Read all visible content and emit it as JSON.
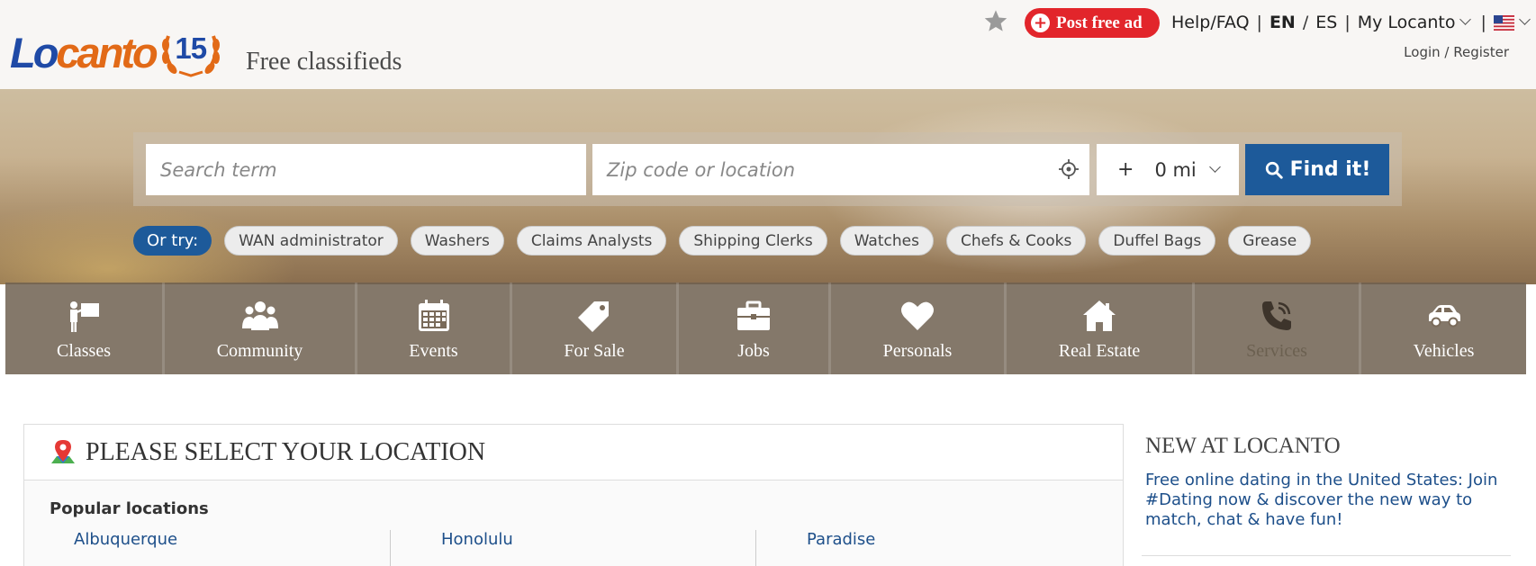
{
  "header": {
    "logo_lo": "Lo",
    "logo_canto": "canto",
    "logo_badge": "15",
    "tagline": "Free classifieds",
    "post_ad": "Post free ad",
    "help": "Help/FAQ",
    "lang_en": "EN",
    "lang_es": "ES",
    "my_locanto": "My Locanto",
    "login": "Login / Register"
  },
  "search": {
    "term_placeholder": "Search term",
    "location_placeholder": "Zip code or location",
    "radius_plus": "+",
    "radius_value": "0 mi",
    "find_label": "Find it!"
  },
  "suggestions": {
    "label": "Or try:",
    "chips": [
      "WAN administrator",
      "Washers",
      "Claims Analysts",
      "Shipping Clerks",
      "Watches",
      "Chefs & Cooks",
      "Duffel Bags",
      "Grease"
    ]
  },
  "categories": [
    {
      "label": "Classes",
      "icon": "classes-icon"
    },
    {
      "label": "Community",
      "icon": "community-icon"
    },
    {
      "label": "Events",
      "icon": "calendar-icon"
    },
    {
      "label": "For Sale",
      "icon": "tag-icon"
    },
    {
      "label": "Jobs",
      "icon": "briefcase-icon"
    },
    {
      "label": "Personals",
      "icon": "heart-icon"
    },
    {
      "label": "Real Estate",
      "icon": "house-icon"
    },
    {
      "label": "Services",
      "icon": "phone-icon"
    },
    {
      "label": "Vehicles",
      "icon": "car-icon"
    }
  ],
  "location_panel": {
    "title": "PLEASE SELECT YOUR LOCATION",
    "popular_title": "Popular locations",
    "locations": [
      "Albuquerque",
      "Honolulu",
      "Paradise"
    ]
  },
  "news": {
    "title": "NEW AT LOCANTO",
    "text": "Free online dating in the United States: Join #Dating now & discover the new way to match, chat & have fun!"
  },
  "colors": {
    "brand_blue": "#1d5a9a",
    "brand_orange": "#e26a17",
    "post_red": "#e2252b"
  }
}
